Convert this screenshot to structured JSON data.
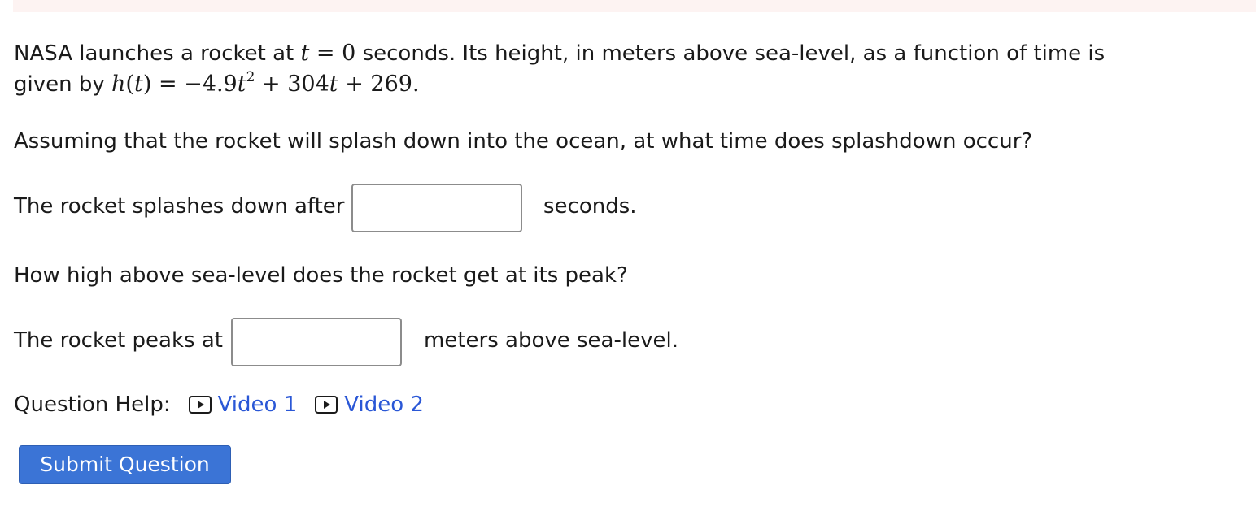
{
  "question": {
    "intro_prefix": "NASA launches a rocket at",
    "var_t": "t",
    "equals": "=",
    "time_zero": "0",
    "intro_suffix": "seconds. Its height, in meters above sea-level, as a function of time is",
    "given_by": "given by",
    "func_h": "h",
    "func_open": "(",
    "func_t": "t",
    "func_close": ")",
    "eq2": "=",
    "expr_a": "−4.9",
    "expr_t1": "t",
    "expr_exp": "2",
    "expr_b": "+ 304",
    "expr_t2": "t",
    "expr_c": "+ 269.",
    "part1_prompt": "Assuming that the rocket will splash down into the ocean, at what time does splashdown occur?",
    "part1_label": "The rocket splashes down after",
    "part1_value": "",
    "part1_unit": "seconds.",
    "part2_prompt": "How high above sea-level does the rocket get at its peak?",
    "part2_label": "The rocket peaks at",
    "part2_value": "",
    "part2_unit": "meters above sea-level."
  },
  "help": {
    "label": "Question Help:",
    "videos": [
      "Video 1",
      "Video 2"
    ],
    "icon": "play-icon",
    "link_color": "#2a57d6"
  },
  "submit": {
    "label": "Submit Question",
    "color": "#3b74d6"
  }
}
